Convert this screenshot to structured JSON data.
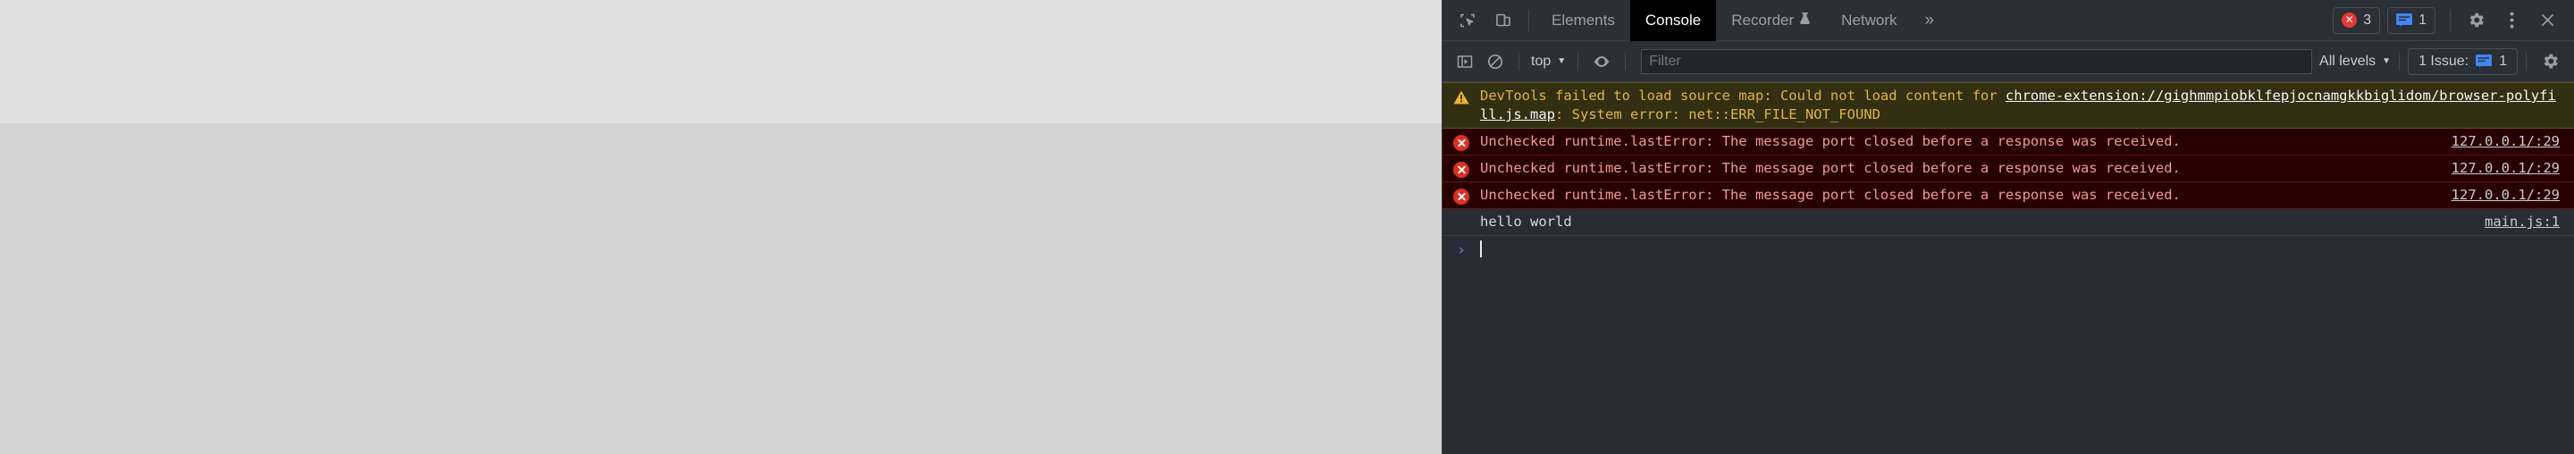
{
  "window": {
    "page_background_top": "#e0e0e0",
    "page_background_bottom": "#d3d3d3"
  },
  "devtools": {
    "tabbar": {
      "inspect_icon": "inspect-element-icon",
      "device_icon": "device-toolbar-icon",
      "tabs": [
        {
          "label": "Elements",
          "active": false
        },
        {
          "label": "Console",
          "active": true
        },
        {
          "label": "Recorder",
          "active": false,
          "suffix": "flask-icon"
        },
        {
          "label": "Network",
          "active": false
        }
      ],
      "more_tabs": "»",
      "error_count": "3",
      "issue_count": "1",
      "settings_icon": "gear-icon",
      "more_icon": "kebab-menu-icon",
      "close_icon": "close-icon"
    },
    "filterbar": {
      "sidebar_icon": "console-sidebar-icon",
      "clear_icon": "clear-console-icon",
      "context": "top",
      "context_caret": "▼",
      "eye_icon": "live-expression-icon",
      "filter_placeholder": "Filter",
      "filter_value": "",
      "levels": "All levels",
      "levels_caret": "▼",
      "issues_label": "1 Issue:",
      "issues_count": "1",
      "settings_icon": "console-settings-icon"
    },
    "messages": [
      {
        "type": "warning",
        "icon": "warning-triangle-icon",
        "segments": [
          {
            "text": "DevTools failed to load source map: Could not load content for ",
            "link": false
          },
          {
            "text": "chrome-extension://gighmmpiobklfepjocnamgkkbiglidom/browser-polyfill.js.map",
            "link": true
          },
          {
            "text": ": System error: net::ERR_FILE_NOT_FOUND",
            "link": false
          }
        ],
        "source": ""
      },
      {
        "type": "error",
        "icon": "error-circle-icon",
        "text": "Unchecked runtime.lastError: The message port closed before a response was received.",
        "source": "127.0.0.1/:29"
      },
      {
        "type": "error",
        "icon": "error-circle-icon",
        "text": "Unchecked runtime.lastError: The message port closed before a response was received.",
        "source": "127.0.0.1/:29"
      },
      {
        "type": "error",
        "icon": "error-circle-icon",
        "text": "Unchecked runtime.lastError: The message port closed before a response was received.",
        "source": "127.0.0.1/:29"
      },
      {
        "type": "log",
        "icon": "",
        "text": "hello world",
        "source": "main.js:1"
      }
    ],
    "prompt": {
      "glyph": "›",
      "value": ""
    }
  },
  "colors": {
    "tab_active_bg": "#000000",
    "panel_bg": "#282c34",
    "toolbar_bg": "#2b2f36",
    "warning_bg": "#322f13",
    "warning_text": "#e3b341",
    "error_bg": "#290000",
    "error_text": "#ef9a9a",
    "error_badge": "#d93025",
    "issue_blue": "#4285f4",
    "prompt_blue": "#5a8dd6"
  }
}
